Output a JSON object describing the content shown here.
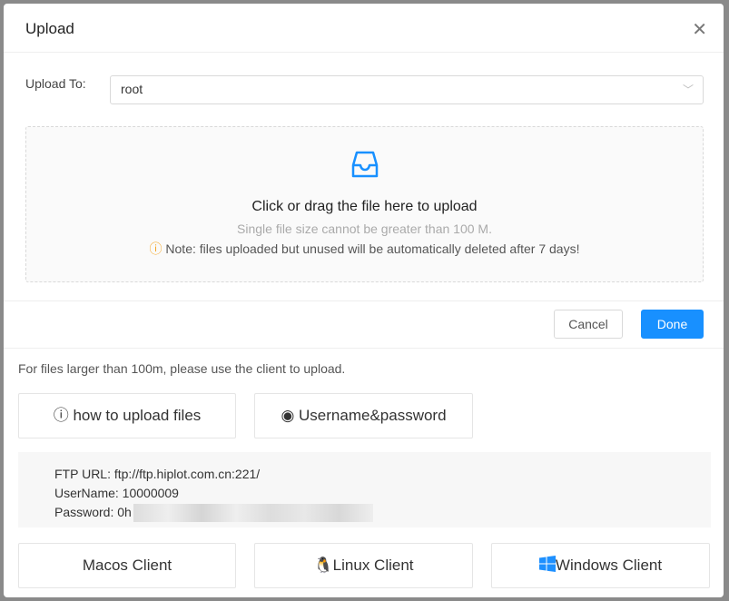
{
  "modal": {
    "title": "Upload",
    "close_icon": "close-icon"
  },
  "upload_to": {
    "label": "Upload To:",
    "value": "root"
  },
  "dragger": {
    "main": "Click or drag the file here to upload",
    "hint": "Single file size cannot be greater than 100 M.",
    "note": "Note: files uploaded but unused will be automatically deleted after 7 days!"
  },
  "footer": {
    "cancel": "Cancel",
    "done": "Done"
  },
  "client": {
    "text": "For files larger than 100m, please use the client to upload.",
    "how_to": "how to upload files",
    "credentials": "Username&password",
    "ftp_url": "FTP URL: ftp://ftp.hiplot.com.cn:221/",
    "username": "UserName: 10000009",
    "password": "Password: 0h",
    "macos": "Macos Client",
    "linux": "Linux Client",
    "windows": "Windows Client"
  },
  "colors": {
    "primary": "#1890ff",
    "warning": "#f5a623",
    "apple": "#1bc8c8",
    "windows": "#1e90ff"
  }
}
